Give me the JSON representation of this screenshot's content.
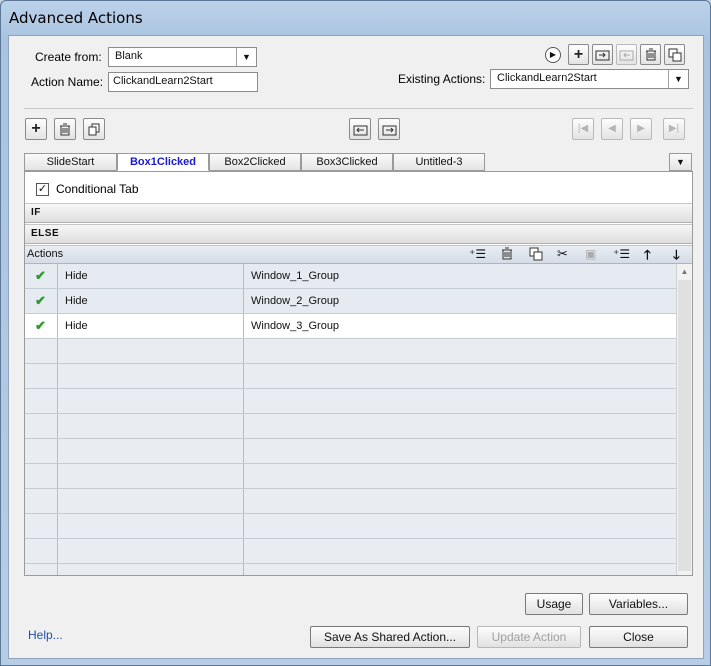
{
  "window": {
    "title": "Advanced Actions"
  },
  "form": {
    "create_from_label": "Create from:",
    "create_from_value": "Blank",
    "action_name_label": "Action Name:",
    "action_name_value": "ClickandLearn2Start",
    "existing_actions_label": "Existing Actions:",
    "existing_actions_value": "ClickandLearn2Start"
  },
  "tabs": [
    {
      "label": "SlideStart"
    },
    {
      "label": "Box1Clicked",
      "active": true
    },
    {
      "label": "Box2Clicked"
    },
    {
      "label": "Box3Clicked"
    },
    {
      "label": "Untitled-3"
    }
  ],
  "panel": {
    "conditional_tab_label": "Conditional Tab",
    "conditional_tab_checked": true,
    "if_label": "IF",
    "else_label": "ELSE",
    "actions_label": "Actions"
  },
  "actions": [
    {
      "action": "Hide",
      "target": "Window_1_Group",
      "enabled": true
    },
    {
      "action": "Hide",
      "target": "Window_2_Group",
      "enabled": true
    },
    {
      "action": "Hide",
      "target": "Window_3_Group",
      "enabled": true
    }
  ],
  "buttons": {
    "usage": "Usage",
    "variables": "Variables...",
    "help": "Help...",
    "save_shared": "Save As Shared Action...",
    "update_action": "Update Action",
    "close": "Close"
  },
  "icons": {
    "play": "play-icon",
    "add": "plus-icon",
    "delete": "trash-icon",
    "duplicate": "duplicate-icon",
    "check": "checkmark-icon"
  }
}
